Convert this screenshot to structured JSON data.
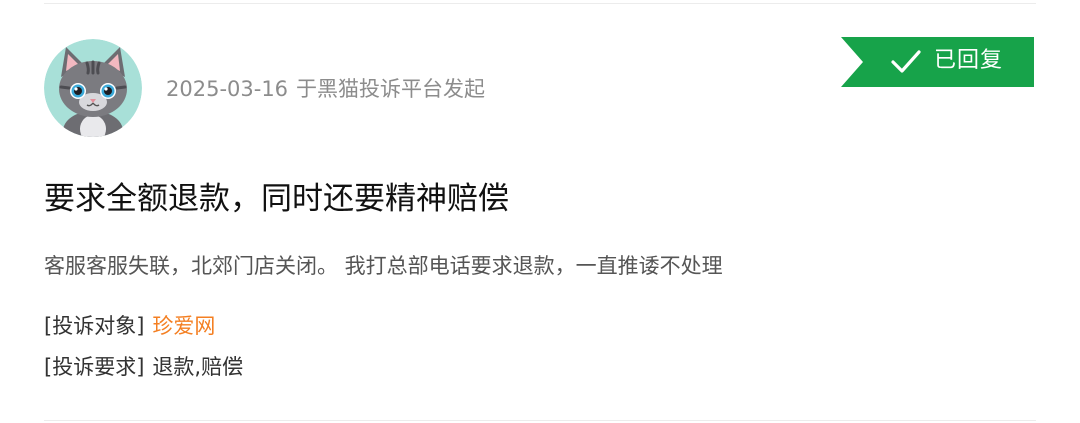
{
  "complaint": {
    "date": "2025-03-16",
    "source_text": "于黑猫投诉平台发起",
    "status_label": "已回复",
    "title": "要求全额退款，同时还要精神赔偿",
    "content": "客服客服失联，北郊门店关闭。 我打总部电话要求退款，一直推诿不处理",
    "target_label": "[投诉对象]",
    "target_value": "珍爱网",
    "demand_label": "[投诉要求]",
    "demand_value": "退款,赔偿"
  },
  "icons": {
    "avatar": "cat-avatar-icon",
    "status": "checkmark-icon"
  },
  "colors": {
    "badge_green": "#17a34a",
    "link_orange": "#f47f22",
    "meta_gray": "#8c8c8c",
    "avatar_bg": "#a8e0d8"
  }
}
